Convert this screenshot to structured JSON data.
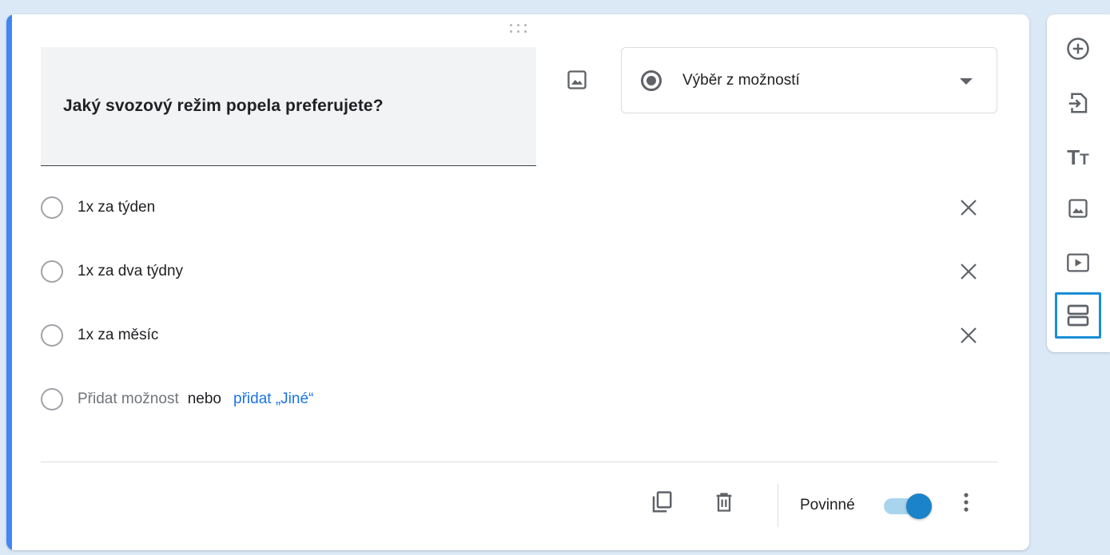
{
  "question": {
    "title": "Jaký svozový režim popela preferujete?",
    "type_label": "Výběr z možností"
  },
  "options": [
    {
      "label": "1x za týden"
    },
    {
      "label": "1x za dva týdny"
    },
    {
      "label": "1x za měsíc"
    }
  ],
  "add_option": {
    "placeholder": "Přidat možnost",
    "or": "nebo",
    "other_link": "přidat „Jiné“"
  },
  "footer": {
    "required_label": "Povinné",
    "required_on": true
  },
  "side_toolbar": {
    "items": [
      "add-circle-icon",
      "import-icon",
      "title-text-icon",
      "image-icon",
      "video-icon",
      "section-icon"
    ],
    "active_item": "section-icon"
  },
  "colors": {
    "accent": "#4285f4",
    "link": "#1a73e8",
    "toggle": "#1a83c9",
    "active_outline": "#1a8fd6",
    "background": "#dbe9f7"
  }
}
